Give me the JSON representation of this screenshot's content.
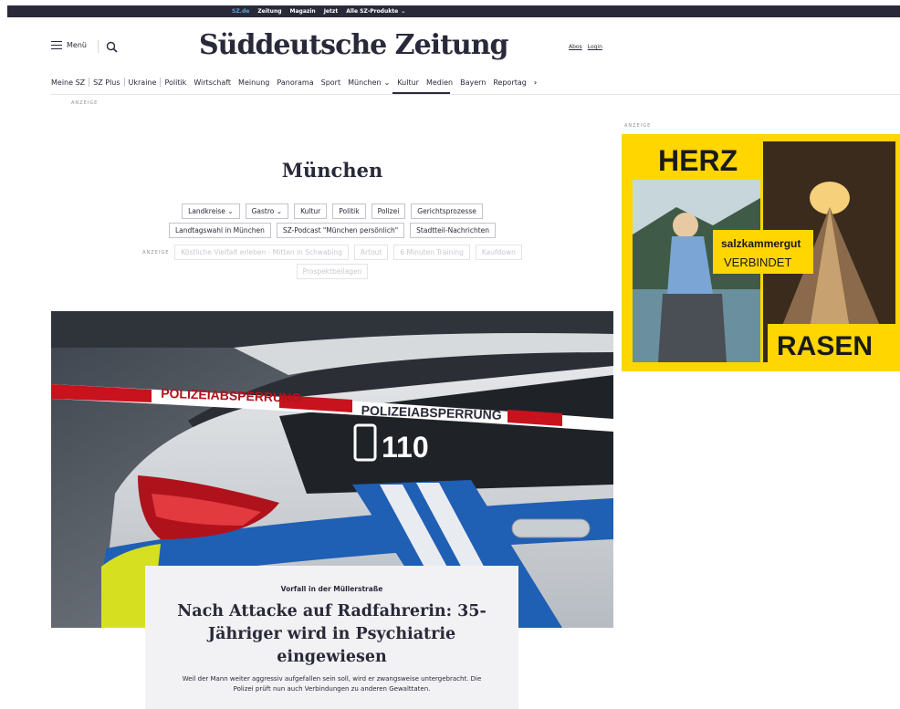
{
  "topbar": {
    "links": [
      {
        "label": "SZ.de",
        "active": true
      },
      {
        "label": "Zeitung",
        "active": false
      },
      {
        "label": "Magazin",
        "active": false
      },
      {
        "label": "Jetzt",
        "active": false
      },
      {
        "label": "Alle SZ-Produkte",
        "active": false
      }
    ],
    "products_icon": "chevron-down-icon"
  },
  "header": {
    "menu_label": "Menü",
    "menu_icon": "hamburger-icon",
    "search_icon": "search-icon",
    "logo": "Süddeutsche Zeitung",
    "abos_label": "Abos",
    "login_label": "Login"
  },
  "nav": {
    "items": [
      "Meine SZ",
      "SZ Plus",
      "Ukraine",
      "Politik",
      "Wirtschaft",
      "Meinung",
      "Panorama",
      "Sport",
      "München",
      "Kultur",
      "Medien",
      "Bayern",
      "Reportag"
    ],
    "active": "München",
    "more_icon": "chevron-right-icon"
  },
  "ad_label": "ANZEIGE",
  "section": {
    "title": "München",
    "tags_row1": [
      "Landkreise",
      "Gastro",
      "Kultur",
      "Politik",
      "Polizei",
      "Gerichtsprozesse"
    ],
    "tags_row2": [
      "Landtagswahl in München",
      "SZ-Podcast \"München persönlich\"",
      "Stadtteil-Nachrichten"
    ],
    "sponsored_row3": [
      "Köstliche Vielfalt erleben - Mitten in Schwabing",
      "Artout",
      "6 Minuten Training",
      "Kaufdown"
    ],
    "sponsored_row4": [
      "Prospektbeilagen"
    ]
  },
  "hero": {
    "tape_text": "POLIZEIABSPERRUNG",
    "car_number": "110",
    "kicker": "Vorfall in der Müllerstraße",
    "headline": "Nach Attacke auf Radfahrerin: 35-Jähriger wird in Psychiatrie eingewiesen",
    "lead": "Weil der Mann weiter aggressiv aufgefallen sein soll, wird er zwangsweise untergebracht. Die Polizei prüft nun auch Verbindungen zu anderen Gewalttaten."
  },
  "ad": {
    "word_top": "HERZ",
    "brand": "salzkammergut",
    "tagline": "VERBINDET",
    "word_bottom": "RASEN"
  },
  "colors": {
    "brand_dark": "#29293a",
    "ad_yellow": "#ffd600",
    "active_link": "#5ea3d6",
    "teaser_bg": "#f2f2f4"
  }
}
